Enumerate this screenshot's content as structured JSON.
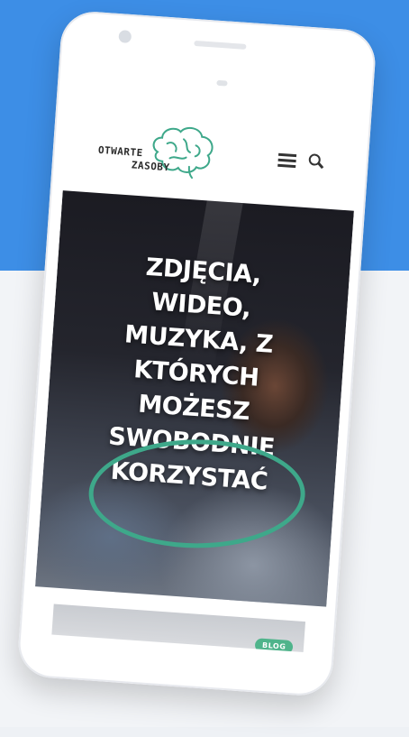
{
  "site": {
    "logo_line1": "OTWARTE",
    "logo_line2": "ZASOBY"
  },
  "hero": {
    "title_lines": [
      "ZDJĘCIA,",
      "WIDEO,",
      "MUZYKA, Z",
      "KTÓRYCH",
      "MOŻESZ",
      "SWOBODNIE",
      "KORZYSTAĆ"
    ]
  },
  "card": {
    "badge": "BLOG"
  },
  "icons": {
    "logo": "brain-icon",
    "menu": "hamburger-menu-icon",
    "search": "search-icon"
  },
  "colors": {
    "background_top": "#3d8ee6",
    "accent_green": "#3ea88a",
    "badge_green": "#4fb48b"
  }
}
